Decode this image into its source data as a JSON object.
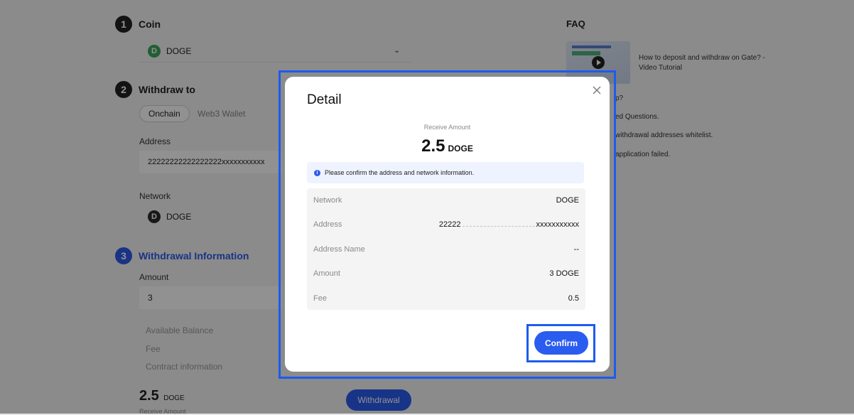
{
  "coin_section": {
    "step": "1",
    "title": "Coin",
    "selected": "DOGE",
    "icon_letter": "D"
  },
  "withdraw_to": {
    "step": "2",
    "title": "Withdraw to",
    "tabs": [
      "Onchain",
      "Web3 Wallet"
    ],
    "address_label": "Address",
    "address_value": "22222222222222222xxxxxxxxxxx",
    "network_label": "Network",
    "network_value": "DOGE",
    "network_letter": "D"
  },
  "withdrawal_info": {
    "step": "3",
    "title": "Withdrawal Information",
    "amount_label": "Amount",
    "amount_value": "3",
    "available_balance": "Available Balance",
    "fee": "Fee",
    "contract": "Contract information",
    "receive_amount_number": "2.5",
    "receive_amount_unit": "DOGE",
    "receive_amount_caption": "Receive Amount",
    "withdraw_button": "Withdrawal"
  },
  "faq": {
    "title": "FAQ",
    "video_title": "How to deposit and withdraw on Gate? - Video Tutorial",
    "items": [
      "p?",
      "ed Questions.",
      "withdrawal addresses whitelist.",
      "application failed."
    ]
  },
  "modal": {
    "title": "Detail",
    "receive_label": "Receive Amount",
    "receive_amount": "2.5",
    "receive_unit": "DOGE",
    "notice": "Please confirm the address and network information.",
    "rows": [
      {
        "key": "Network",
        "value": "DOGE"
      },
      {
        "key": "Address",
        "value_start": "22222",
        "value_end": "xxxxxxxxxxx"
      },
      {
        "key": "Address Name",
        "value": "--"
      },
      {
        "key": "Amount",
        "value": "3 DOGE"
      },
      {
        "key": "Fee",
        "value": "0.5"
      }
    ],
    "confirm_button": "Confirm"
  },
  "colors": {
    "accent": "#2b5cf0",
    "highlight": "#1d5bf0",
    "doge_green": "#3aa55d"
  }
}
